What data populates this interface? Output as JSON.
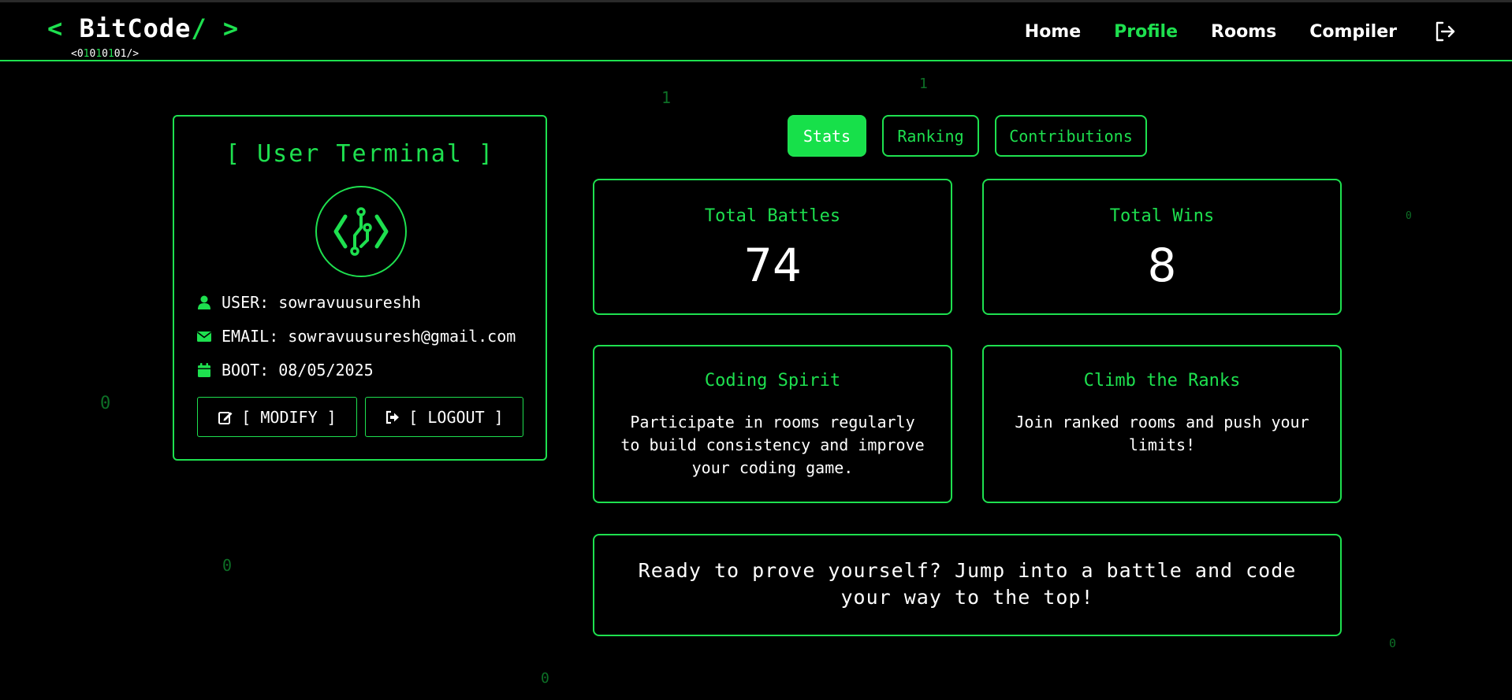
{
  "header": {
    "logo": {
      "left_bracket": "<",
      "name": "BitCode",
      "right_bracket": "/ >",
      "sub_prefix": "<",
      "sub_bits": [
        "0",
        "1",
        "0",
        "1",
        "0",
        "1",
        "0",
        "1"
      ],
      "sub_suffix": "/>"
    },
    "nav": [
      "Home",
      "Profile",
      "Rooms",
      "Compiler"
    ],
    "active_nav": "Profile"
  },
  "background_digits": [
    "1",
    "1",
    "0",
    "0",
    "0",
    "0",
    "0"
  ],
  "profile": {
    "title": "[ User Terminal ]",
    "user": "USER: sowravuusureshh",
    "email": "EMAIL: sowravuusuresh@gmail.com",
    "boot": "BOOT: 08/05/2025",
    "modify_label": "[ MODIFY ]",
    "logout_label": "[ LOGOUT ]"
  },
  "tabs": [
    "Stats",
    "Ranking",
    "Contributions"
  ],
  "active_tab": "Stats",
  "stats": {
    "total_battles_label": "Total Battles",
    "total_battles": "74",
    "total_wins_label": "Total Wins",
    "total_wins": "8"
  },
  "tips": {
    "spirit_title": "Coding Spirit",
    "spirit_text": "Participate in rooms regularly to build consistency and improve your coding game.",
    "ranks_title": "Climb the Ranks",
    "ranks_text": "Join ranked rooms and push your limits!"
  },
  "banner": "Ready to prove yourself? Jump into a battle and code your way to the top!",
  "colors": {
    "accent": "#1ee04f",
    "background": "#000000",
    "bg_digit": "#0d6f26"
  },
  "icons": [
    "logout-icon",
    "user-icon",
    "envelope-icon",
    "calendar-icon",
    "edit-icon",
    "sign-out-icon",
    "code-circuit-icon"
  ]
}
